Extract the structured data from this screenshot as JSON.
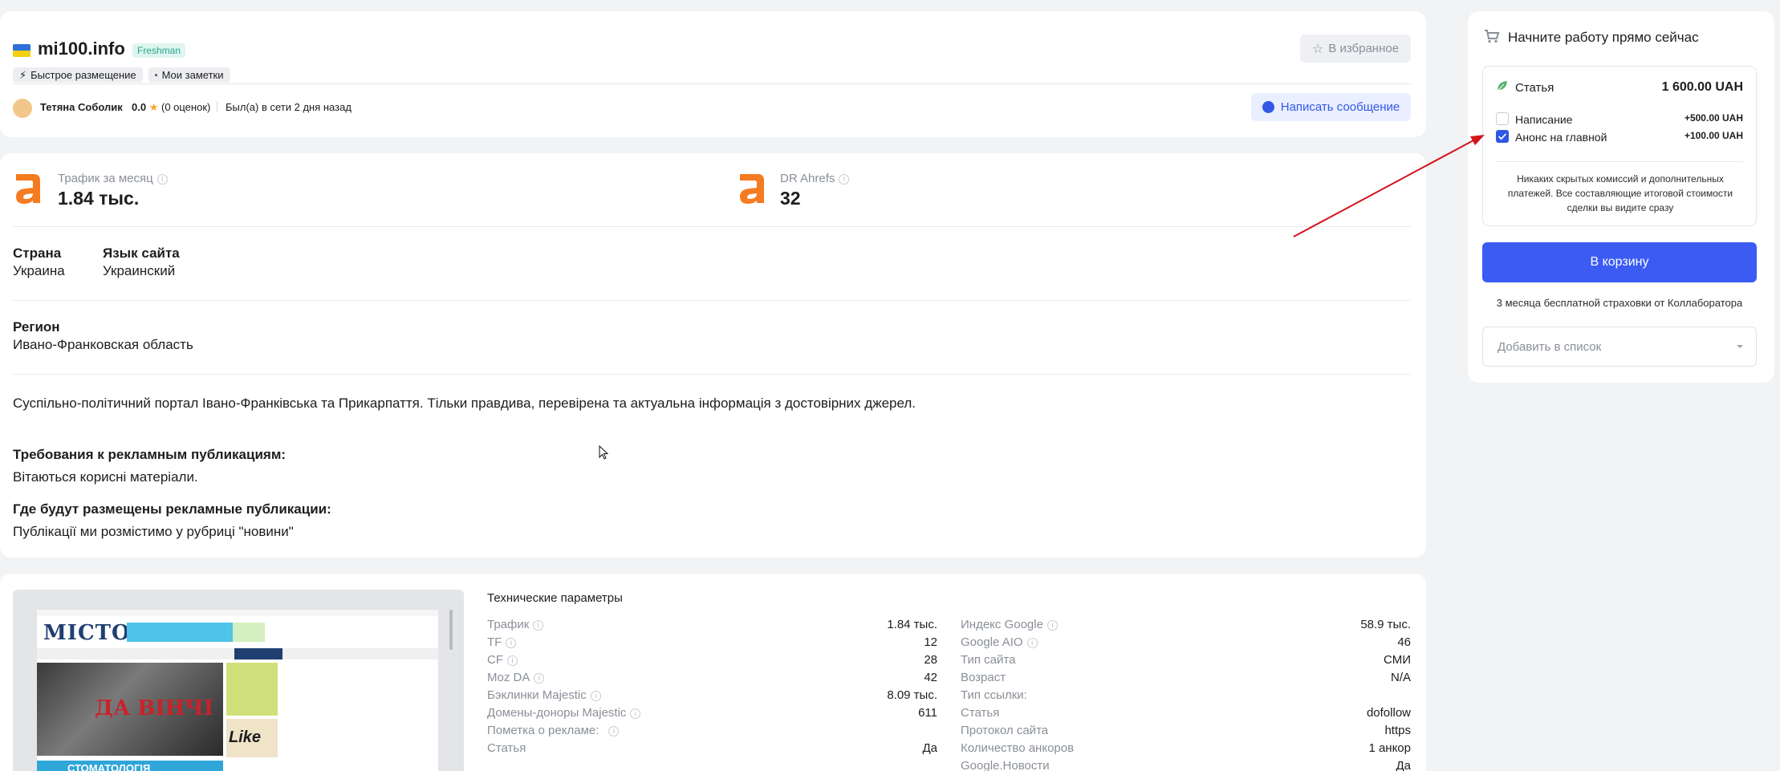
{
  "site": {
    "name": "mi100.info",
    "level_badge": "Freshman",
    "tags": [
      "Быстрое размещение",
      "Мои заметки"
    ],
    "favorite_label": "В избранное"
  },
  "owner": {
    "name": "Тетяна Соболик",
    "rating": "0.0",
    "reviews": "(0 оценок)",
    "last_seen": "Был(а) в сети 2 дня назад",
    "message_label": "Написать сообщение"
  },
  "metrics": {
    "traffic": {
      "label": "Трафик за месяц",
      "value": "1.84 тыс."
    },
    "dr": {
      "label": "DR Ahrefs",
      "value": "32"
    }
  },
  "info": {
    "country_title": "Страна",
    "country": "Украина",
    "language_title": "Язык сайта",
    "language": "Украинский",
    "region_title": "Регион",
    "region": "Ивано-Франковская область",
    "description": "Суспільно-політичний портал Івано-Франківська та Прикарпаття. Тільки правдива, перевірена та актуальна інформація з достовірних джерел.",
    "requirements_title": "Требования к рекламным публикациям:",
    "requirements": "Вітаються корисні матеріали.",
    "placement_title": "Где будут размещены рекламные публикации:",
    "placement": "Публікації ми розмістимо у рубриці \"новини\""
  },
  "tech": {
    "title": "Технические параметры",
    "left": [
      {
        "label": "Трафик",
        "value": "1.84 тыс."
      },
      {
        "label": "TF",
        "value": "12"
      },
      {
        "label": "CF",
        "value": "28"
      },
      {
        "label": "Moz DA",
        "value": "42"
      },
      {
        "label": "Бэклинки Majestic",
        "value": "8.09 тыс."
      },
      {
        "label": "Домены-доноры Majestic",
        "value": "611"
      },
      {
        "label": "Пометка о рекламе:",
        "value": ""
      },
      {
        "label": "Статья",
        "value": "Да"
      }
    ],
    "right": [
      {
        "label": "Индекс Google",
        "value": "58.9 тыс."
      },
      {
        "label": "Google AIO",
        "value": "46"
      },
      {
        "label": "Тип сайта",
        "value": "СМИ"
      },
      {
        "label": "Возраст",
        "value": "N/A"
      },
      {
        "label": "Тип ссылки:",
        "value": ""
      },
      {
        "label": "Статья",
        "value": "dofollow"
      },
      {
        "label": "Протокол сайта",
        "value": "https"
      },
      {
        "label": "Количество анкоров",
        "value": "1 анкор"
      },
      {
        "label": "Google.Новости",
        "value": "Да"
      }
    ]
  },
  "preview": {
    "logo": "МІСТО",
    "headline": "ДА ВІНЧІ",
    "banner_bottom": "СТОМАТОЛОГІЯ",
    "side_logo": "Like"
  },
  "order": {
    "title": "Начните работу прямо сейчас",
    "article_label": "Статья",
    "article_price": "1 600.00 UAH",
    "options": [
      {
        "label": "Написание",
        "price": "+500.00 UAH",
        "checked": false
      },
      {
        "label": "Анонс на главной",
        "price": "+100.00 UAH",
        "checked": true
      }
    ],
    "note": "Никаких скрытых комиссий и дополнительных платежей. Все составляющие итоговой стоимости сделки вы видите сразу",
    "cart_label": "В корзину",
    "insurance": "3 месяца бесплатной страховки от Коллаборатора",
    "list_placeholder": "Добавить в список"
  },
  "colors": {
    "accent": "#3b5bf3",
    "ahrefs": "#f47b20",
    "arrow": "#d4141c"
  }
}
